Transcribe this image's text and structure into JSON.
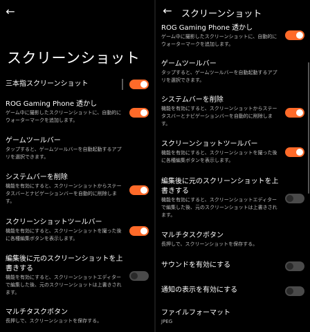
{
  "left": {
    "page_title": "スクリーンショット",
    "items": [
      {
        "title": "三本指スクリーンショット",
        "desc": "",
        "toggle": "on"
      },
      {
        "title": "ROG Gaming Phone 透かし",
        "desc": "ゲーム中に撮影したスクリーンショットに、自動的にウォーターマークを追加します。",
        "toggle": "on"
      },
      {
        "title": "ゲームツールバー",
        "desc": "タップすると、ゲームツールバーを自動起動するアプリを選択できます。",
        "toggle": null
      },
      {
        "title": "システムバーを削除",
        "desc": "機能を有効にすると、スクリーンショットからステータスバーとナビゲーションバーを自動的に削除します。",
        "toggle": "on"
      },
      {
        "title": "スクリーンショットツールバー",
        "desc": "機能を有効にすると、スクリーンショットを撮った後に各種編集ボタンを表示します。",
        "toggle": "on"
      },
      {
        "title": "編集後に元のスクリーンショットを上書きする",
        "desc": "機能を有効にすると、スクリーンショットエディターで編集した後、元のスクリーンショットは上書きされます。",
        "toggle": "off"
      },
      {
        "title": "マルチタスクボタン",
        "desc": "長押しで、スクリーンショットを保存する。",
        "toggle": null
      }
    ]
  },
  "right": {
    "header_title": "スクリーンショット",
    "items": [
      {
        "title": "ROG Gaming Phone 透かし",
        "desc": "ゲーム中に撮影したスクリーンショットに、自動的にウォーターマークを追加します。",
        "toggle": "on"
      },
      {
        "title": "ゲームツールバー",
        "desc": "タップすると、ゲームツールバーを自動起動するアプリを選択できます。",
        "toggle": null
      },
      {
        "title": "システムバーを削除",
        "desc": "機能を有効にすると、スクリーンショットからステータスバーとナビゲーションバーを自動的に削除します。",
        "toggle": "on"
      },
      {
        "title": "スクリーンショットツールバー",
        "desc": "機能を有効にすると、スクリーンショットを撮った後に各種編集ボタンを表示します。",
        "toggle": "on"
      },
      {
        "title": "編集後に元のスクリーンショットを上書きする",
        "desc": "機能を有効にすると、スクリーンショットエディターで編集した後、元のスクリーンショットは上書きされます。",
        "toggle": "off"
      },
      {
        "title": "マルチタスクボタン",
        "desc": "長押しで、スクリーンショットを保存する。",
        "toggle": null
      },
      {
        "title": "サウンドを有効にする",
        "desc": "",
        "toggle": "off"
      },
      {
        "title": "通知の表示を有効にする",
        "desc": "",
        "toggle": "off"
      },
      {
        "title": "ファイルフォーマット",
        "desc": "JPEG",
        "toggle": null
      }
    ]
  },
  "colors": {
    "accent": "#ff6a29",
    "toggle_off": "#4a4a4a",
    "background": "#000000",
    "secondary_text": "#bdbdbd"
  },
  "icons": {
    "back": "arrow-left-icon"
  }
}
